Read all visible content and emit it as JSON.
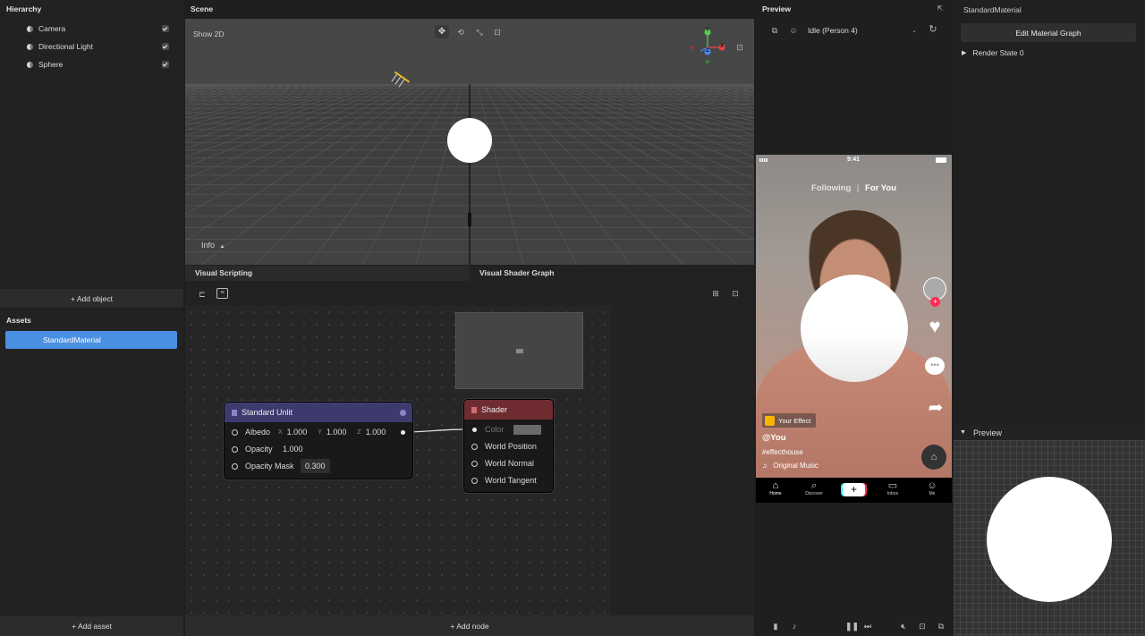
{
  "hierarchy": {
    "title": "Hierarchy",
    "items": [
      {
        "label": "Camera"
      },
      {
        "label": "Directional Light"
      },
      {
        "label": "Sphere"
      }
    ],
    "add_object": "+ Add object"
  },
  "assets": {
    "title": "Assets",
    "items": [
      {
        "label": "StandardMaterial"
      }
    ],
    "add_asset": "+ Add asset"
  },
  "scene": {
    "title": "Scene",
    "show2d": "Show 2D",
    "info": "Info",
    "gizmo": {
      "y": "Y",
      "x": "X",
      "z": "Z"
    }
  },
  "bottom_tabs": {
    "visual_scripting": "Visual Scripting",
    "visual_shader_graph": "Visual Shader Graph"
  },
  "graph": {
    "add_node": "+ Add node",
    "standard_unlit": {
      "title": "Standard Unlit",
      "albedo_label": "Albedo",
      "albedo_x_label": "X",
      "albedo_x": "1.000",
      "albedo_y_label": "Y",
      "albedo_y": "1.000",
      "albedo_z_label": "Z",
      "albedo_z": "1.000",
      "opacity_label": "Opacity",
      "opacity": "1.000",
      "opacity_mask_label": "Opacity Mask",
      "opacity_mask": "0.300"
    },
    "shader": {
      "title": "Shader",
      "color_label": "Color",
      "ports": [
        "World Position",
        "World Normal",
        "World Tangent"
      ]
    }
  },
  "preview": {
    "title": "Preview",
    "person": "Idle (Person 4)",
    "phone": {
      "time": "9:41",
      "following": "Following",
      "separator": "|",
      "for_you": "For You",
      "effect_badge": "Your Effect",
      "username": "@You",
      "hashtag": "#effecthouse",
      "music": "Original Music",
      "nav": [
        "Home",
        "Discover",
        "Inbox",
        "Me"
      ]
    }
  },
  "inspector": {
    "title": "StandardMaterial",
    "edit_button": "Edit Material Graph",
    "render_state": "Render State 0",
    "preview_title": "Preview"
  },
  "colors": {
    "accent": "#4a90e2",
    "unlit_header": "#3d3b6e",
    "shader_header": "#6e2c30",
    "tiktok_pink": "#fe2c55"
  }
}
